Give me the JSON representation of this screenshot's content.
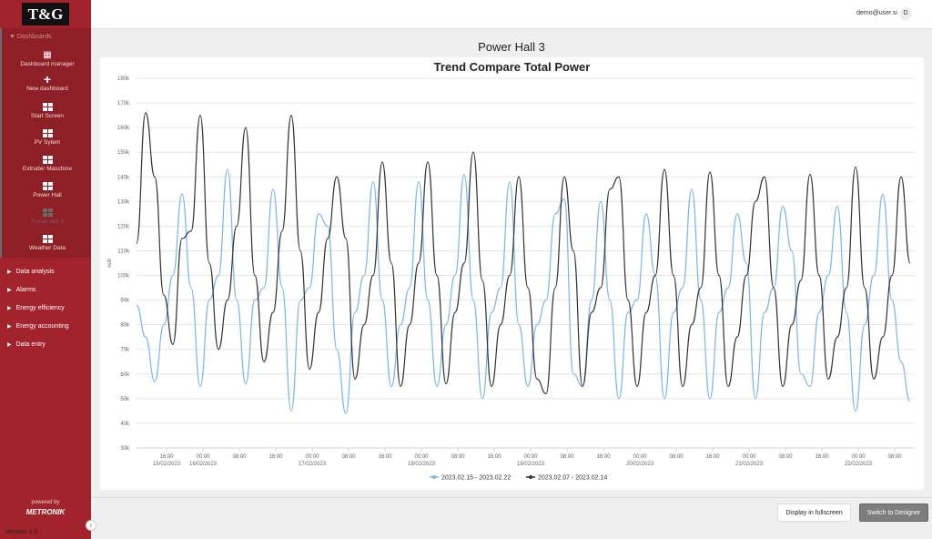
{
  "sidebar": {
    "logo": "T&G",
    "group": "Dashboards",
    "dashboards": [
      {
        "label": "Dashboard manager",
        "icon": "dashboard-manager-icon"
      },
      {
        "label": "New dashboard",
        "icon": "plus-icon"
      },
      {
        "label": "Start Screen",
        "icon": "grid-icon"
      },
      {
        "label": "PV Sytem",
        "icon": "grid-icon"
      },
      {
        "label": "Extruder Maschine",
        "icon": "grid-icon"
      },
      {
        "label": "Power Hall",
        "icon": "grid-icon"
      },
      {
        "label": "Power hall 3",
        "icon": "grid-icon"
      },
      {
        "label": "Weather Data",
        "icon": "grid-icon"
      }
    ],
    "menu": [
      "Data analysis",
      "Alarms",
      "Energy efficiency",
      "Energy accounting",
      "Data entry"
    ],
    "powered_by": "powered by",
    "brand": "METRONIK",
    "version": "Version 1.3"
  },
  "topbar": {
    "user": "demo@user.si",
    "avatar": "D"
  },
  "page_title": "Power Hall 3",
  "footer": {
    "fullscreen": "Display in fullscreen",
    "designer": "Switch to Designer"
  },
  "colors": {
    "sidebar": "#a3232c",
    "series1": "#7cb5ec",
    "series2": "#333333"
  },
  "chart_data": {
    "type": "line",
    "title": "Trend Compare Total Power",
    "ylabel": "null",
    "ylim": [
      30000,
      180000
    ],
    "yticks": [
      "30k",
      "40k",
      "50k",
      "60k",
      "70k",
      "80k",
      "90k",
      "100k",
      "110k",
      "120k",
      "130k",
      "140k",
      "150k",
      "160k",
      "170k",
      "180k"
    ],
    "x_start_hours_before_first_tick": 6.6,
    "step_hours": 2,
    "xticks": [
      {
        "t": "16:00",
        "d": "15/02/2023"
      },
      {
        "t": "00:00",
        "d": "16/02/2023"
      },
      {
        "t": "08:00",
        "d": ""
      },
      {
        "t": "16:00",
        "d": ""
      },
      {
        "t": "00:00",
        "d": "17/02/2023"
      },
      {
        "t": "08:00",
        "d": ""
      },
      {
        "t": "16:00",
        "d": ""
      },
      {
        "t": "00:00",
        "d": "18/02/2023"
      },
      {
        "t": "08:00",
        "d": ""
      },
      {
        "t": "16:00",
        "d": ""
      },
      {
        "t": "00:00",
        "d": "19/02/2023"
      },
      {
        "t": "08:00",
        "d": ""
      },
      {
        "t": "16:00",
        "d": ""
      },
      {
        "t": "00:00",
        "d": "20/02/2023"
      },
      {
        "t": "08:00",
        "d": ""
      },
      {
        "t": "16:00",
        "d": ""
      },
      {
        "t": "00:00",
        "d": "21/02/2023"
      },
      {
        "t": "08:00",
        "d": ""
      },
      {
        "t": "16:00",
        "d": ""
      },
      {
        "t": "00:00",
        "d": "22/02/2023"
      },
      {
        "t": "08:00",
        "d": ""
      }
    ],
    "legend_position": "bottom-center",
    "series": [
      {
        "name": "2023.02.15 - 2023.02.22",
        "color": "#7cb5ec",
        "values": [
          88,
          75,
          57,
          80,
          100,
          133,
          95,
          55,
          90,
          100,
          143,
          90,
          56,
          90,
          95,
          135,
          95,
          45,
          90,
          95,
          125,
          120,
          70,
          44,
          85,
          100,
          138,
          90,
          55,
          80,
          95,
          138,
          90,
          55,
          80,
          100,
          141,
          90,
          50,
          85,
          95,
          138,
          80,
          55,
          80,
          90,
          125,
          131,
          60,
          55,
          90,
          130,
          90,
          50,
          85,
          90,
          125,
          100,
          50,
          85,
          95,
          135,
          90,
          50,
          85,
          95,
          125,
          105,
          50,
          85,
          95,
          128,
          110,
          60,
          55,
          85,
          100,
          128,
          85,
          45,
          80,
          100,
          133,
          90,
          65,
          49
        ]
      },
      {
        "name": "2023.02.07 - 2023.02.14",
        "color": "#333333",
        "values": [
          113,
          166,
          140,
          92,
          72,
          115,
          118,
          165,
          105,
          70,
          90,
          120,
          160,
          100,
          65,
          85,
          118,
          165,
          110,
          62,
          85,
          115,
          140,
          115,
          58,
          80,
          100,
          146,
          105,
          55,
          80,
          105,
          146,
          100,
          56,
          85,
          105,
          150,
          98,
          55,
          80,
          100,
          140,
          95,
          58,
          52,
          95,
          140,
          110,
          55,
          85,
          95,
          135,
          140,
          90,
          55,
          85,
          100,
          143,
          100,
          55,
          80,
          95,
          142,
          100,
          55,
          75,
          100,
          130,
          140,
          95,
          55,
          80,
          98,
          141,
          100,
          58,
          75,
          95,
          144,
          95,
          58,
          75,
          100,
          140,
          105
        ]
      }
    ]
  }
}
